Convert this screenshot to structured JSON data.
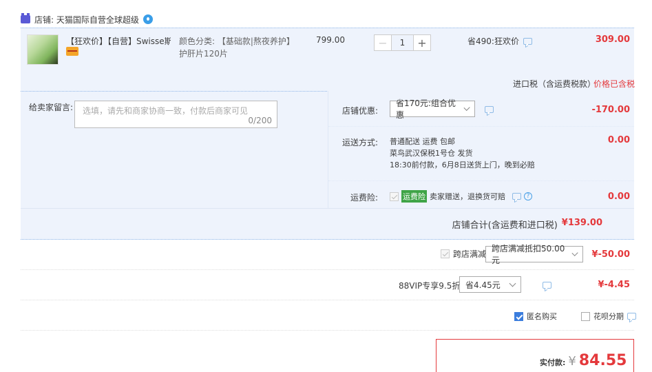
{
  "shop": {
    "label": "店铺: 天猫国际自营全球超级"
  },
  "item": {
    "title": "【狂欢价】【自营】Swisse斯...",
    "sku_label": "颜色分类:",
    "sku_value_line1": "【基础款|熬夜养护】",
    "sku_value_line2": "护肝片120片",
    "unit_price": "799.00",
    "quantity": "1",
    "promo": "省490:狂欢价",
    "subtotal": "309.00",
    "tax_label": "进口税（含运费税款）",
    "tax_value": "价格已含税"
  },
  "memo": {
    "label": "给卖家留言:",
    "placeholder": "选填，请先和商家协商一致，付款后商家可见",
    "counter": "0/200"
  },
  "shop_discount": {
    "label": "店铺优惠:",
    "selected": "省170元:组合优惠",
    "value": "-170.00"
  },
  "shipping": {
    "label": "运送方式:",
    "line1": "普通配送 运费 包邮",
    "line2": "菜鸟武汉保税1号仓",
    "line2b": "发货",
    "line3": "18:30前付款，6月8日送货上门，晚到必赔",
    "value": "0.00"
  },
  "insurance": {
    "label": "运费险:",
    "tag": "运费险",
    "text": "卖家赠送，退换货可赔",
    "value": "0.00"
  },
  "shop_total": {
    "label": "店铺合计(含运费和进口税)",
    "value": "¥139.00"
  },
  "cross_store": {
    "label": "跨店满减",
    "selected": "跨店满减抵扣50.00元",
    "value": "¥-50.00"
  },
  "vip": {
    "label": "88VIP专享9.5折",
    "selected": "省4.45元",
    "value": "¥-4.45"
  },
  "options": {
    "anonymous": "匿名购买",
    "installment": "花呗分期"
  },
  "payment": {
    "label": "实付款:",
    "currency": "¥",
    "amount": "84.55"
  },
  "colors": {
    "accent_red": "#e4393c",
    "band_blue": "#eef3fc",
    "link_blue": "#3b7ddd"
  }
}
